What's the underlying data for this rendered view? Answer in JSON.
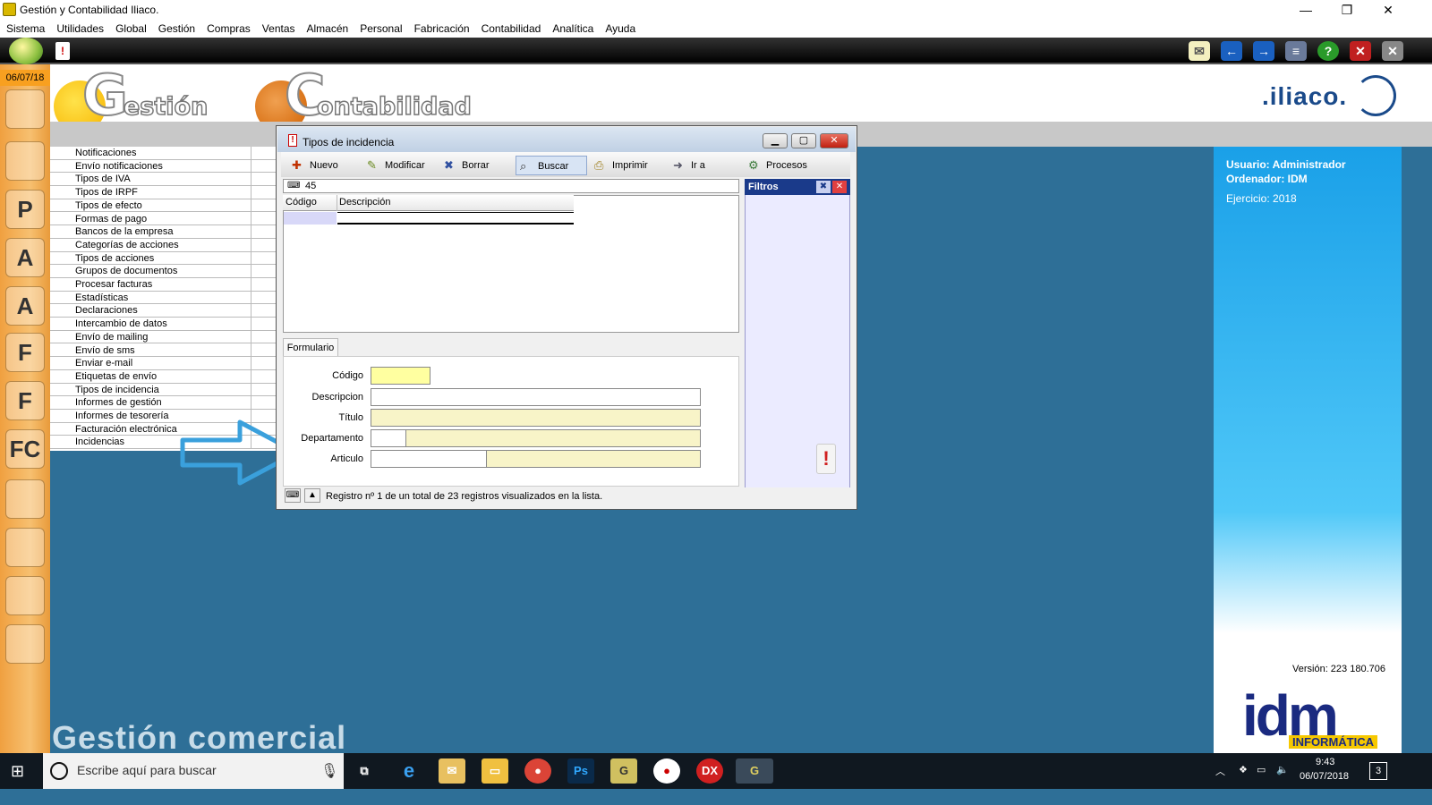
{
  "window": {
    "title": "Gestión y Contabilidad Iliaco.",
    "minimize": "—",
    "restore": "❐",
    "close": "✕"
  },
  "menu": [
    "Sistema",
    "Utilidades",
    "Global",
    "Gestión",
    "Compras",
    "Ventas",
    "Almacén",
    "Personal",
    "Fabricación",
    "Contabilidad",
    "Analítica",
    "Ayuda"
  ],
  "date": "06/07/18",
  "logos": {
    "gestion_letter": "G",
    "gestion_text": "estión",
    "contab_letter": "C",
    "contab_text": "ontabilidad",
    "iliaco": ".iliaco."
  },
  "sidebar_icons": [
    "users-icon",
    "user-icon",
    "user-p-icon",
    "user-a-icon",
    "book-a-icon",
    "book-f-icon",
    "book-f2-icon",
    "book-fc-icon",
    "bag-green-icon",
    "bag-orange-icon",
    "ledger-icon",
    "cd-tools-icon"
  ],
  "sidebar_letters": [
    "",
    "",
    "P",
    "A",
    "A",
    "F",
    "F",
    "FC",
    "",
    "",
    "",
    ""
  ],
  "side_menu": [
    "Notificaciones",
    "Envío notificaciones",
    "Tipos de IVA",
    "Tipos de IRPF",
    "Tipos de efecto",
    "Formas de pago",
    "Bancos de la empresa",
    "Categorías de acciones",
    "Tipos de acciones",
    "Grupos de documentos",
    "Procesar facturas",
    "Estadísticas",
    "Declaraciones",
    "Intercambio de datos",
    "Envío de mailing",
    "Envío de sms",
    "Enviar e-mail",
    "Etiquetas de envío",
    "Tipos de incidencia",
    "Informes de gestión",
    "Informes de tesorería",
    "Facturación electrónica",
    "Incidencias"
  ],
  "module_name": "Gestión comercial",
  "right_panel": {
    "usuario": "Usuario: Administrador",
    "ordenador": "Ordenador: IDM",
    "ejercicio": "Ejercicio: 2018",
    "version": "Versión: 223 180.706",
    "brand": "idm",
    "brand_sub": "INFORMÁTICA"
  },
  "dialog": {
    "title": "Tipos de incidencia",
    "toolbar": {
      "nuevo": "Nuevo",
      "modificar": "Modificar",
      "borrar": "Borrar",
      "buscar": "Buscar",
      "imprimir": "Imprimir",
      "ira": "Ir a",
      "procesos": "Procesos"
    },
    "search_value": "45",
    "columns": {
      "codigo": "Código",
      "descripcion": "Descripción"
    },
    "filters_title": "Filtros",
    "form_tab": "Formulario",
    "fields": {
      "codigo": "Código",
      "descripcion": "Descripcion",
      "titulo": "Título",
      "departamento": "Departamento",
      "articulo": "Articulo"
    },
    "status": "Registro nº 1 de un total de 23 registros visualizados en la lista."
  },
  "colors": {
    "accent": "#1aa0e8",
    "filters_header": "#1a3a8a",
    "required_field": "#ffffa0",
    "readonly_field": "#f8f4c8",
    "arrow": "#3aa0dc"
  },
  "taskbar": {
    "search_placeholder": "Escribe aquí para buscar",
    "time": "9:43",
    "date": "06/07/2018",
    "notifications": "3"
  }
}
